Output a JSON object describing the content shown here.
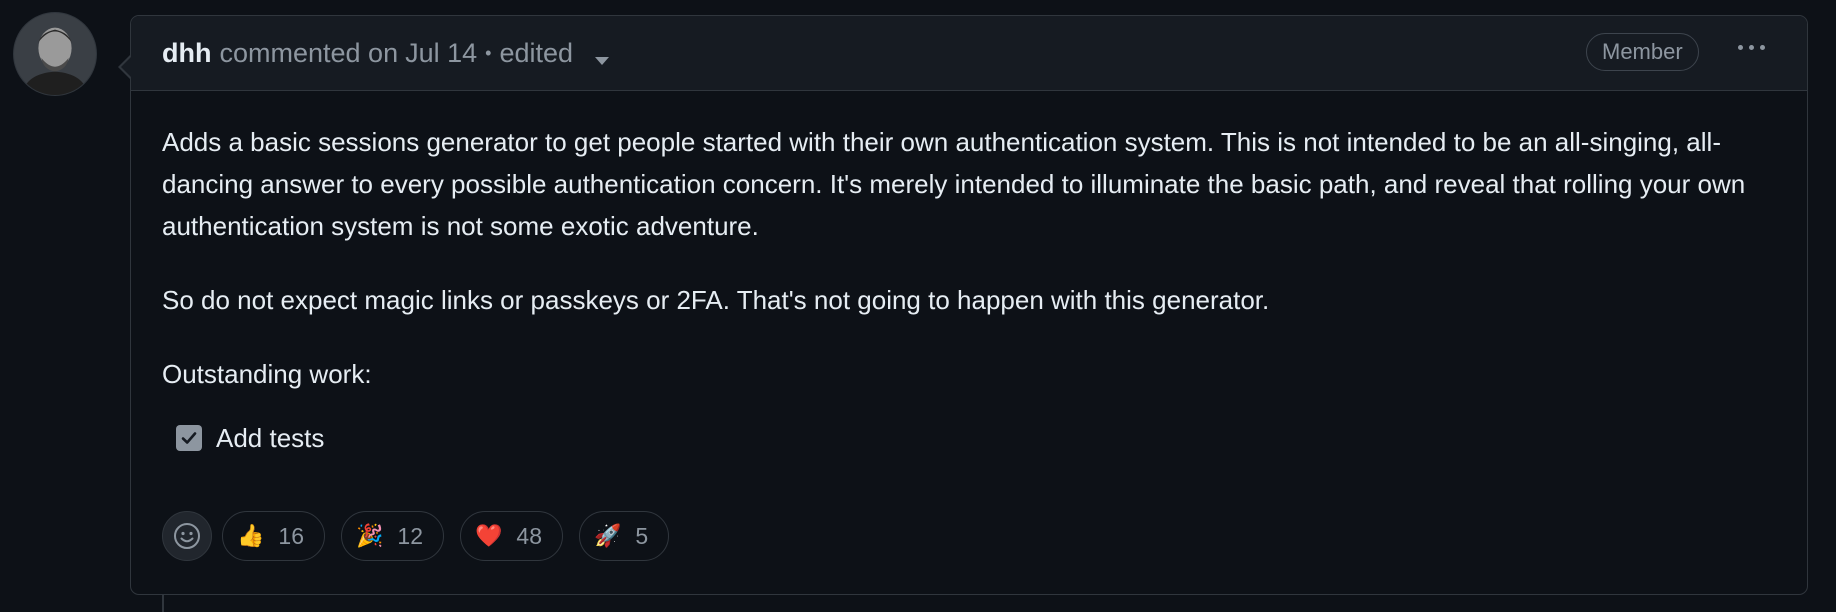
{
  "comment": {
    "author": "dhh",
    "action": "commented on",
    "date": "Jul 14",
    "edited_label": "edited",
    "badge": "Member",
    "paragraphs": [
      "Adds a basic sessions generator to get people started with their own authentication system. This is not intended to be an all-singing, all-dancing answer to every possible authentication concern. It's merely intended to illuminate the basic path, and reveal that rolling your own authentication system is not some exotic adventure.",
      "So do not expect magic links or passkeys or 2FA. That's not going to happen with this generator.",
      "Outstanding work:"
    ],
    "tasks": [
      {
        "label": "Add tests",
        "checked": true
      }
    ]
  },
  "reactions": [
    {
      "emoji": "👍",
      "icon": "thumbs-up-icon",
      "count": "16"
    },
    {
      "emoji": "🎉",
      "icon": "party-popper-icon",
      "count": "12"
    },
    {
      "emoji": "❤️",
      "icon": "heart-icon",
      "count": "48"
    },
    {
      "emoji": "🚀",
      "icon": "rocket-icon",
      "count": "5"
    }
  ],
  "colors": {
    "background": "#0d1117",
    "header_background": "#161b22",
    "border": "#30363d",
    "text": "#e6edf3",
    "muted": "#8d96a0"
  }
}
